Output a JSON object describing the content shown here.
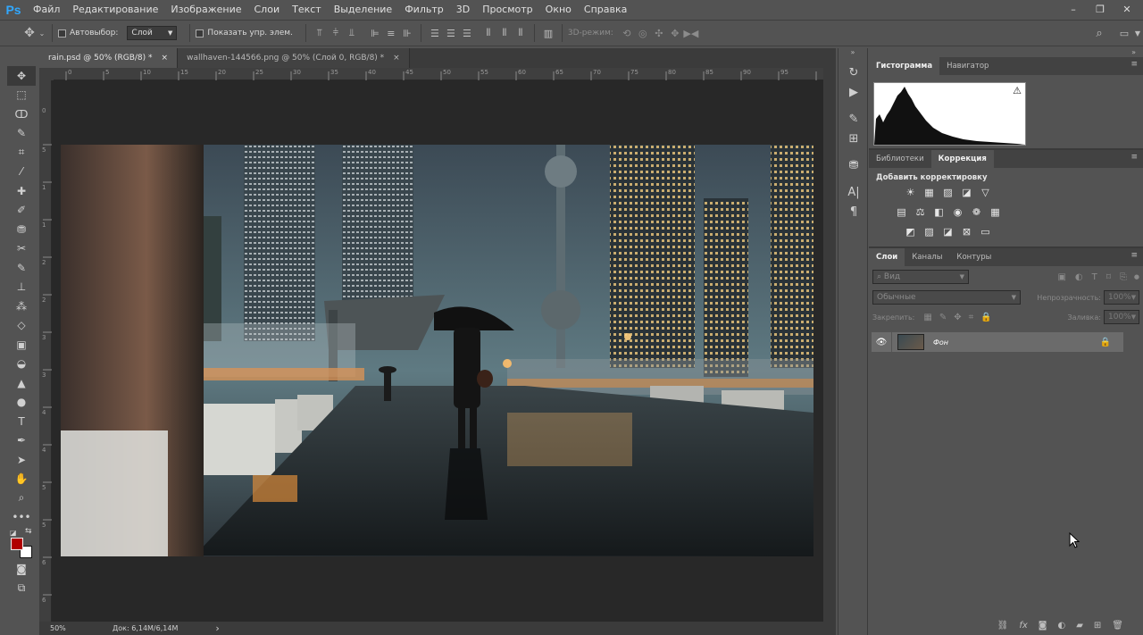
{
  "app": {
    "logo": "Ps"
  },
  "menu": [
    "Файл",
    "Редактирование",
    "Изображение",
    "Слои",
    "Текст",
    "Выделение",
    "Фильтр",
    "3D",
    "Просмотр",
    "Окно",
    "Справка"
  ],
  "window_controls": [
    "–",
    "❐",
    "✕"
  ],
  "options": {
    "autoselect_label": "Автовыбор:",
    "autoselect_value": "Слой",
    "show_controls_label": "Показать упр. элем.",
    "mode3d_label": "3D-режим:"
  },
  "tabs": [
    {
      "title": "rain.psd @ 50% (RGB/8) *",
      "close": "×"
    },
    {
      "title": "wallhaven-144566.png @ 50% (Слой 0, RGB/8) *",
      "close": "×"
    }
  ],
  "ruler_h": [
    "0",
    "5",
    "10",
    "15",
    "20",
    "25",
    "30",
    "35",
    "40",
    "45",
    "50",
    "55",
    "60",
    "65",
    "70",
    "75",
    "80",
    "85",
    "90",
    "95"
  ],
  "ruler_v": [
    "0",
    "5",
    "1",
    "1",
    "2",
    "2",
    "3",
    "3",
    "4",
    "4",
    "5",
    "5",
    "6",
    "6",
    "7"
  ],
  "status": {
    "zoom": "50%",
    "doc": "Док: 6,14M/6,14M",
    "arrow": "›"
  },
  "panels": {
    "group1_tabs": [
      "Гистограмма",
      "Навигатор"
    ],
    "hist_warning": "⚠",
    "group2_tabs": [
      "Библиотеки",
      "Коррекция"
    ],
    "add_adjustment": "Добавить корректировку",
    "group3_tabs": [
      "Слои",
      "Каналы",
      "Контуры"
    ],
    "layer_filter_placeholder": "Вид",
    "blend_mode": "Обычные",
    "opacity_label": "Непрозрачность:",
    "opacity_value": "100%",
    "lock_label": "Закрепить:",
    "fill_label": "Заливка:",
    "fill_value": "100%",
    "layers": [
      {
        "name": "Фон",
        "visible": true,
        "locked": true
      }
    ]
  },
  "colors": {
    "foreground": "#b00000",
    "background": "#ffffff",
    "ps_blue": "#31a8ff"
  }
}
